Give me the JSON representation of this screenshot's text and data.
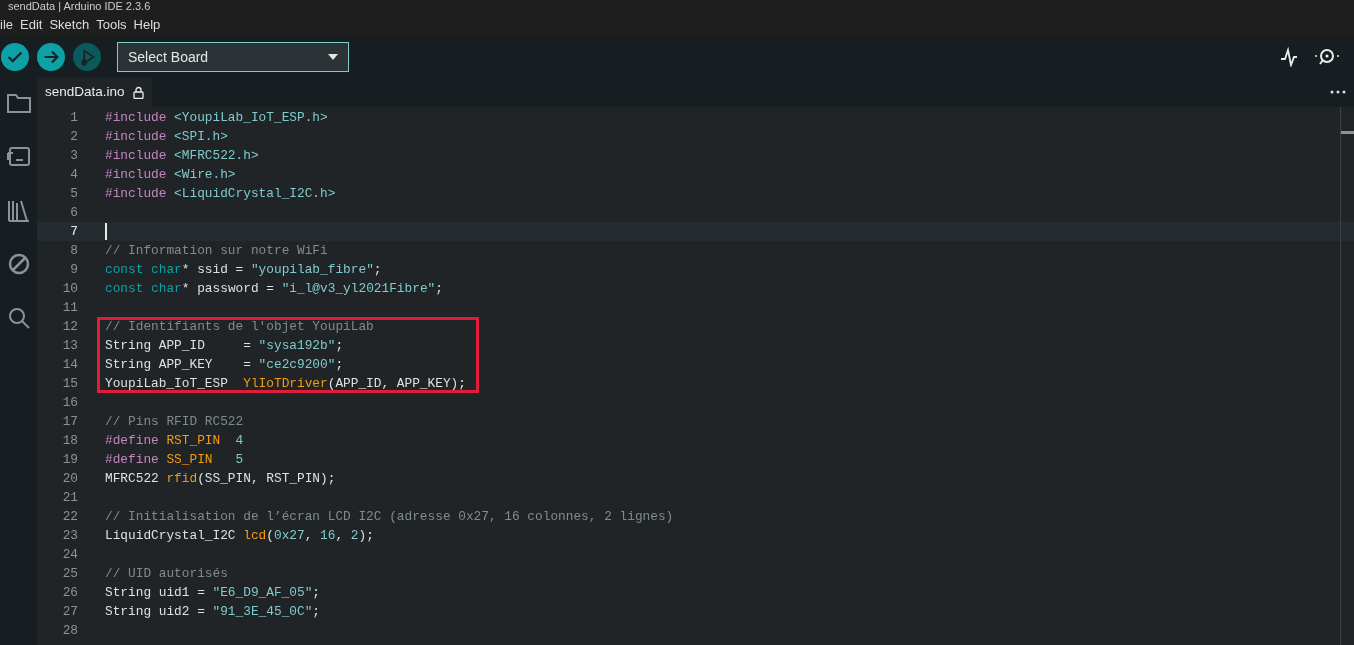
{
  "window": {
    "title": "sendData | Arduino IDE 2.3.6"
  },
  "menu": [
    "ile",
    "Edit",
    "Sketch",
    "Tools",
    "Help"
  ],
  "toolbar": {
    "buttons": [
      {
        "kind": "verify",
        "disabled": false
      },
      {
        "kind": "upload",
        "disabled": false
      },
      {
        "kind": "debug",
        "disabled": true
      }
    ],
    "board_select": {
      "value": "Select Board"
    },
    "right_buttons": [
      {
        "kind": "plotter"
      },
      {
        "kind": "monitor"
      }
    ]
  },
  "sidebar": {
    "items": [
      {
        "kind": "folder",
        "selected": false
      },
      {
        "kind": "board",
        "selected": false
      },
      {
        "kind": "library",
        "selected": false
      },
      {
        "kind": "debug",
        "selected": false
      },
      {
        "kind": "search",
        "selected": false
      }
    ]
  },
  "tabs": [
    {
      "label": "sendData.ino",
      "selected": true,
      "locked": true
    }
  ],
  "editor": {
    "lines": [
      {
        "number": "1",
        "current": false,
        "highlighted": false,
        "tokens": [
          {
            "kind": "preproc",
            "text": "#include"
          },
          {
            "kind": "path",
            "text": " <YoupiLab_IoT_ESP.h>"
          }
        ]
      },
      {
        "number": "2",
        "current": false,
        "highlighted": false,
        "tokens": [
          {
            "kind": "preproc",
            "text": "#include"
          },
          {
            "kind": "path",
            "text": " <SPI.h>"
          }
        ]
      },
      {
        "number": "3",
        "current": false,
        "highlighted": false,
        "tokens": [
          {
            "kind": "preproc",
            "text": "#include"
          },
          {
            "kind": "path",
            "text": " <MFRC522.h>"
          }
        ]
      },
      {
        "number": "4",
        "current": false,
        "highlighted": false,
        "tokens": [
          {
            "kind": "preproc",
            "text": "#include"
          },
          {
            "kind": "path",
            "text": " <Wire.h>"
          }
        ]
      },
      {
        "number": "5",
        "current": false,
        "highlighted": false,
        "tokens": [
          {
            "kind": "preproc",
            "text": "#include"
          },
          {
            "kind": "path",
            "text": " <LiquidCrystal_I2C.h>"
          }
        ]
      },
      {
        "number": "6",
        "current": false,
        "highlighted": false
      },
      {
        "number": "7",
        "current": true,
        "highlighted": false
      },
      {
        "number": "8",
        "current": false,
        "highlighted": false,
        "tokens": [
          {
            "kind": "comment",
            "text": "// Information sur notre WiFi"
          }
        ]
      },
      {
        "number": "9",
        "current": false,
        "highlighted": false,
        "tokens": [
          {
            "kind": "type",
            "text": "const"
          },
          {
            "kind": "type",
            "text": " char"
          },
          {
            "kind": "plain",
            "text": "* ssid = "
          },
          {
            "kind": "string",
            "text": "\"youpilab_fibre\""
          },
          {
            "kind": "plain",
            "text": ";"
          }
        ]
      },
      {
        "number": "10",
        "current": false,
        "highlighted": false,
        "tokens": [
          {
            "kind": "type",
            "text": "const"
          },
          {
            "kind": "type",
            "text": " char"
          },
          {
            "kind": "plain",
            "text": "* password = "
          },
          {
            "kind": "string",
            "text": "\"i_l@v3_yl2021Fibre\""
          },
          {
            "kind": "plain",
            "text": ";"
          }
        ]
      },
      {
        "number": "11",
        "current": false,
        "highlighted": false
      },
      {
        "number": "12",
        "current": false,
        "highlighted": true,
        "tokens": [
          {
            "kind": "comment",
            "text": "// Identifiants de l'objet YoupiLab"
          }
        ]
      },
      {
        "number": "13",
        "current": false,
        "highlighted": true,
        "tokens": [
          {
            "kind": "plain",
            "text": "String APP_ID     = "
          },
          {
            "kind": "string",
            "text": "\"sysa192b\""
          },
          {
            "kind": "plain",
            "text": ";"
          }
        ]
      },
      {
        "number": "14",
        "current": false,
        "highlighted": true,
        "tokens": [
          {
            "kind": "plain",
            "text": "String APP_KEY    = "
          },
          {
            "kind": "string",
            "text": "\"ce2c9200\""
          },
          {
            "kind": "plain",
            "text": ";"
          }
        ]
      },
      {
        "number": "15",
        "current": false,
        "highlighted": true,
        "tokens": [
          {
            "kind": "plain",
            "text": "YoupiLab_IoT_ESP  "
          },
          {
            "kind": "func",
            "text": "YlIoTDriver"
          },
          {
            "kind": "plain",
            "text": "(APP_ID, APP_KEY);"
          }
        ]
      },
      {
        "number": "16",
        "current": false,
        "highlighted": false
      },
      {
        "number": "17",
        "current": false,
        "highlighted": false,
        "tokens": [
          {
            "kind": "comment",
            "text": "// Pins RFID RC522"
          }
        ]
      },
      {
        "number": "18",
        "current": false,
        "highlighted": false,
        "tokens": [
          {
            "kind": "preproc",
            "text": "#define"
          },
          {
            "kind": "func",
            "text": " RST_PIN"
          },
          {
            "kind": "number",
            "text": "  4"
          }
        ]
      },
      {
        "number": "19",
        "current": false,
        "highlighted": false,
        "tokens": [
          {
            "kind": "preproc",
            "text": "#define"
          },
          {
            "kind": "func",
            "text": " SS_PIN"
          },
          {
            "kind": "number",
            "text": "   5"
          }
        ]
      },
      {
        "number": "20",
        "current": false,
        "highlighted": false,
        "tokens": [
          {
            "kind": "plain",
            "text": "MFRC522 "
          },
          {
            "kind": "func",
            "text": "rfid"
          },
          {
            "kind": "plain",
            "text": "(SS_PIN, RST_PIN);"
          }
        ]
      },
      {
        "number": "21",
        "current": false,
        "highlighted": false
      },
      {
        "number": "22",
        "current": false,
        "highlighted": false,
        "tokens": [
          {
            "kind": "comment",
            "text": "// Initialisation de l’écran LCD I2C (adresse 0x27, 16 colonnes, 2 lignes)"
          }
        ]
      },
      {
        "number": "23",
        "current": false,
        "highlighted": false,
        "tokens": [
          {
            "kind": "plain",
            "text": "LiquidCrystal_I2C "
          },
          {
            "kind": "func",
            "text": "lcd"
          },
          {
            "kind": "plain",
            "text": "("
          },
          {
            "kind": "number",
            "text": "0x27"
          },
          {
            "kind": "plain",
            "text": ", "
          },
          {
            "kind": "number",
            "text": "16"
          },
          {
            "kind": "plain",
            "text": ", "
          },
          {
            "kind": "number",
            "text": "2"
          },
          {
            "kind": "plain",
            "text": ");"
          }
        ]
      },
      {
        "number": "24",
        "current": false,
        "highlighted": false
      },
      {
        "number": "25",
        "current": false,
        "highlighted": false,
        "tokens": [
          {
            "kind": "comment",
            "text": "// UID autorisés"
          }
        ]
      },
      {
        "number": "26",
        "current": false,
        "highlighted": false,
        "tokens": [
          {
            "kind": "plain",
            "text": "String uid1 = "
          },
          {
            "kind": "string",
            "text": "\"E6_D9_AF_05\""
          },
          {
            "kind": "plain",
            "text": ";"
          }
        ]
      },
      {
        "number": "27",
        "current": false,
        "highlighted": false,
        "tokens": [
          {
            "kind": "plain",
            "text": "String uid2 = "
          },
          {
            "kind": "string",
            "text": "\"91_3E_45_0C\""
          },
          {
            "kind": "plain",
            "text": ";"
          }
        ]
      },
      {
        "number": "28",
        "current": false,
        "highlighted": false
      }
    ]
  }
}
